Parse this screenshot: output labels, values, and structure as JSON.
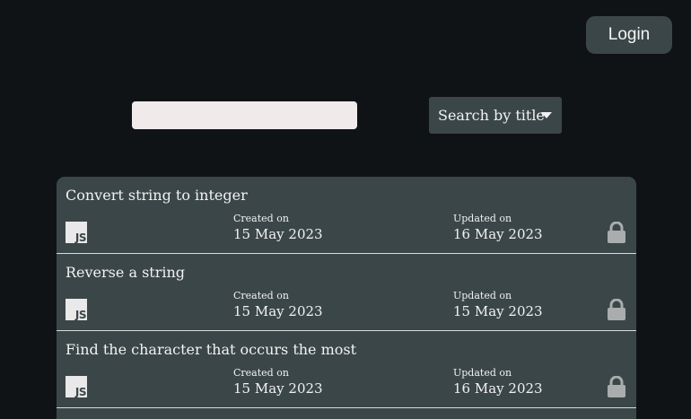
{
  "header": {
    "login_label": "Login"
  },
  "search": {
    "value": "",
    "placeholder": "",
    "mode_label": "Search by title"
  },
  "problems": [
    {
      "title": "Convert string to integer",
      "language_badge": "JS",
      "created_label": "Created on",
      "created_date": "15 May 2023",
      "updated_label": "Updated on",
      "updated_date": "16 May 2023",
      "lock_icon": "lock-icon"
    },
    {
      "title": "Reverse a string",
      "language_badge": "JS",
      "created_label": "Created on",
      "created_date": "15 May 2023",
      "updated_label": "Updated on",
      "updated_date": "15 May 2023",
      "lock_icon": "lock-icon"
    },
    {
      "title": "Find the character that occurs the most",
      "language_badge": "JS",
      "created_label": "Created on",
      "created_date": "15 May 2023",
      "updated_label": "Updated on",
      "updated_date": "16 May 2023",
      "lock_icon": "lock-icon"
    }
  ],
  "colors": {
    "background": "#101316",
    "panel": "#3b4648",
    "input": "#f0eaea",
    "lock": "#a9adad"
  }
}
